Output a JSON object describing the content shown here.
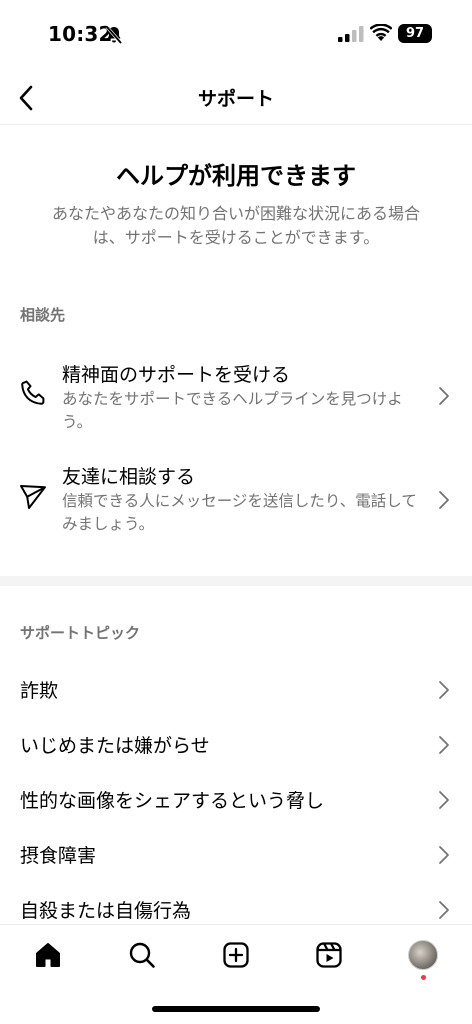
{
  "status": {
    "time": "10:32",
    "battery": "97"
  },
  "nav": {
    "title": "サポート"
  },
  "hero": {
    "title": "ヘルプが利用できます",
    "description": "あなたやあなたの知り合いが困難な状況にある場合は、サポートを受けることができます。"
  },
  "contacts": {
    "label": "相談先",
    "items": [
      {
        "title": "精神面のサポートを受ける",
        "subtitle": "あなたをサポートできるヘルプラインを見つけよう。",
        "icon": "phone-icon"
      },
      {
        "title": "友達に相談する",
        "subtitle": "信頼できる人にメッセージを送信したり、電話してみましょう。",
        "icon": "send-icon"
      }
    ]
  },
  "topics": {
    "label": "サポートトピック",
    "items": [
      "詐欺",
      "いじめまたは嫌がらせ",
      "性的な画像をシェアするという脅し",
      "摂食障害",
      "自殺または自傷行為"
    ]
  },
  "tab_bar": {
    "items": [
      "home-icon",
      "search-icon",
      "create-icon",
      "reels-icon",
      "profile-avatar"
    ],
    "notification_color": "#ff3040"
  }
}
